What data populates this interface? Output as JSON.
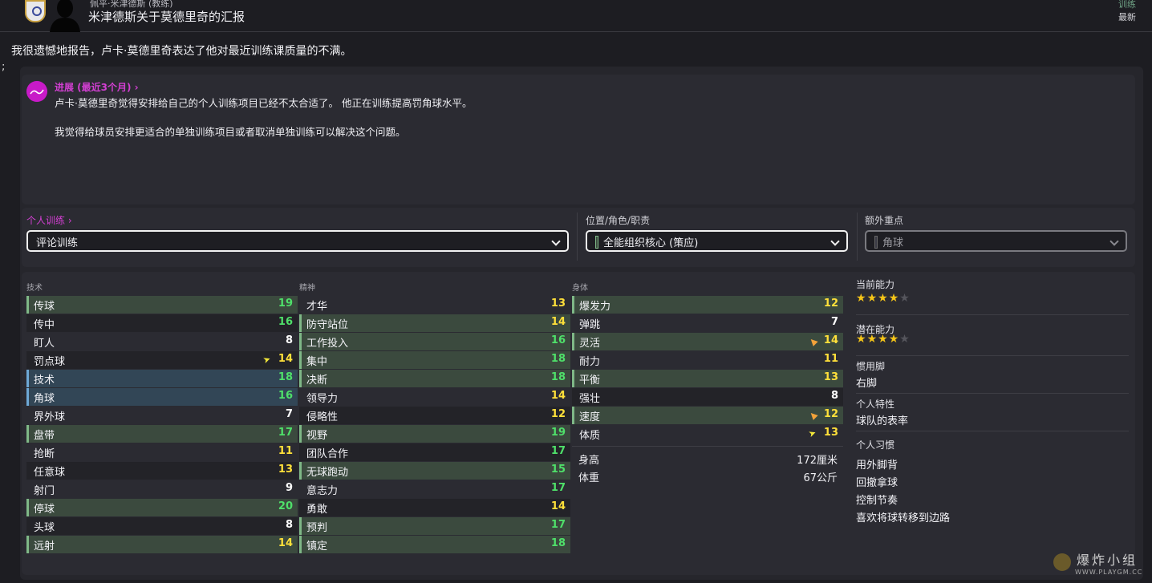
{
  "header": {
    "sender": "佩平·米津德斯 (教练)",
    "subject": "米津德斯关于莫德里奇的汇报",
    "tag": "训练",
    "latest": "最新"
  },
  "intro": "我很遗憾地报告，卢卡·莫德里奇表达了他对最近训练课质量的不满。",
  "semicolon": ";",
  "report": {
    "progress_link": "进展 (最近3个月) ›",
    "line1": "卢卡·莫德里奇觉得安排给自己的个人训练项目已经不太合适了。 他正在训练提高罚角球水平。",
    "line2": "我觉得给球员安排更适合的单独训练项目或者取消单独训练可以解决这个问题。"
  },
  "training": {
    "individual_label": "个人训练 ›",
    "individual_value": "评论训练",
    "role_label": "位置/角色/职责",
    "role_value": "全能组织核心 (策应)",
    "extra_label": "额外重点",
    "extra_value": "角球"
  },
  "technical": {
    "header": "技术",
    "rows": [
      {
        "name": "传球",
        "value": "19"
      },
      {
        "name": "传中",
        "value": "16"
      },
      {
        "name": "盯人",
        "value": "8"
      },
      {
        "name": "罚点球",
        "value": "14"
      },
      {
        "name": "技术",
        "value": "18"
      },
      {
        "name": "角球",
        "value": "16"
      },
      {
        "name": "界外球",
        "value": "7"
      },
      {
        "name": "盘带",
        "value": "17"
      },
      {
        "name": "抢断",
        "value": "11"
      },
      {
        "name": "任意球",
        "value": "13"
      },
      {
        "name": "射门",
        "value": "9"
      },
      {
        "name": "停球",
        "value": "20"
      },
      {
        "name": "头球",
        "value": "8"
      },
      {
        "name": "远射",
        "value": "14"
      }
    ]
  },
  "mental": {
    "header": "精神",
    "rows": [
      {
        "name": "才华",
        "value": "13"
      },
      {
        "name": "防守站位",
        "value": "14"
      },
      {
        "name": "工作投入",
        "value": "16"
      },
      {
        "name": "集中",
        "value": "18"
      },
      {
        "name": "决断",
        "value": "18"
      },
      {
        "name": "领导力",
        "value": "14"
      },
      {
        "name": "侵略性",
        "value": "12"
      },
      {
        "name": "视野",
        "value": "19"
      },
      {
        "name": "团队合作",
        "value": "17"
      },
      {
        "name": "无球跑动",
        "value": "15"
      },
      {
        "name": "意志力",
        "value": "17"
      },
      {
        "name": "勇敢",
        "value": "14"
      },
      {
        "name": "预判",
        "value": "17"
      },
      {
        "name": "镇定",
        "value": "18"
      }
    ]
  },
  "physical": {
    "header": "身体",
    "rows": [
      {
        "name": "爆发力",
        "value": "12"
      },
      {
        "name": "弹跳",
        "value": "7"
      },
      {
        "name": "灵活",
        "value": "14"
      },
      {
        "name": "耐力",
        "value": "11"
      },
      {
        "name": "平衡",
        "value": "13"
      },
      {
        "name": "强壮",
        "value": "8"
      },
      {
        "name": "速度",
        "value": "12"
      },
      {
        "name": "体质",
        "value": "13"
      }
    ],
    "height_label": "身高",
    "height_value": "172厘米",
    "weight_label": "体重",
    "weight_value": "67公斤"
  },
  "side": {
    "current_ability": "当前能力",
    "current_stars": 4,
    "potential_ability": "潜在能力",
    "potential_stars": 4,
    "foot_label": "惯用脚",
    "foot_value": "右脚",
    "trait_label": "个人特性",
    "trait_value": "球队的表率",
    "habits_label": "个人习惯",
    "habits": [
      "用外脚背",
      "回撤拿球",
      "控制节奏",
      "喜欢将球转移到边路"
    ]
  },
  "watermark": {
    "title": "爆炸小组",
    "url": "WWW.PLAYGM.CC"
  },
  "colors": {
    "accent": "#c81ac8",
    "green_value": "#4fe06a",
    "yellow_value": "#ffe03a"
  }
}
